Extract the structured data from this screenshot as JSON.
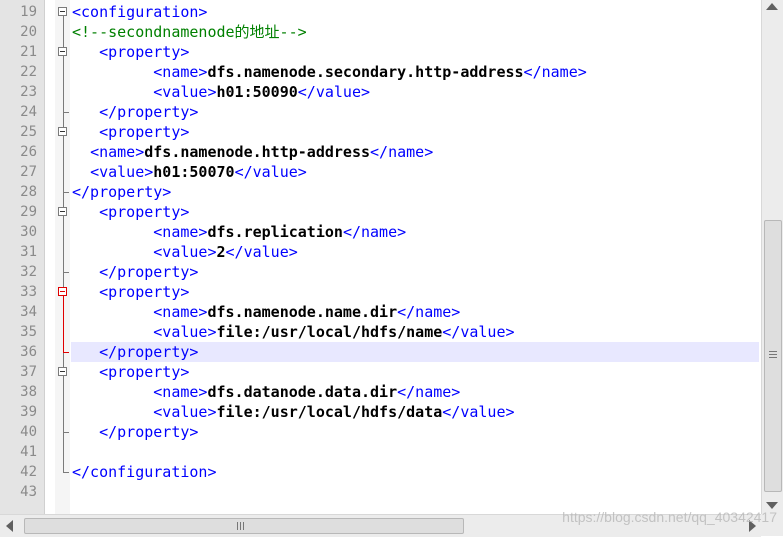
{
  "editor": {
    "lines": [
      {
        "num": "19",
        "indent": "",
        "parts": [
          {
            "t": "tag",
            "v": "<configuration>"
          }
        ]
      },
      {
        "num": "20",
        "indent": "",
        "parts": [
          {
            "t": "cmt",
            "v": "<!--secondnamenode的地址-->"
          }
        ]
      },
      {
        "num": "21",
        "indent": "   ",
        "parts": [
          {
            "t": "tag",
            "v": "<property>"
          }
        ]
      },
      {
        "num": "22",
        "indent": "         ",
        "parts": [
          {
            "t": "tag",
            "v": "<name>"
          },
          {
            "t": "val",
            "v": "dfs.namenode.secondary.http-address"
          },
          {
            "t": "tag",
            "v": "</name>"
          }
        ]
      },
      {
        "num": "23",
        "indent": "         ",
        "parts": [
          {
            "t": "tag",
            "v": "<value>"
          },
          {
            "t": "val",
            "v": "h01:50090"
          },
          {
            "t": "tag",
            "v": "</value>"
          }
        ]
      },
      {
        "num": "24",
        "indent": "   ",
        "parts": [
          {
            "t": "tag",
            "v": "</property>"
          }
        ]
      },
      {
        "num": "25",
        "indent": "   ",
        "parts": [
          {
            "t": "tag",
            "v": "<property>"
          }
        ]
      },
      {
        "num": "26",
        "indent": "  ",
        "parts": [
          {
            "t": "tag",
            "v": "<name>"
          },
          {
            "t": "val",
            "v": "dfs.namenode.http-address"
          },
          {
            "t": "tag",
            "v": "</name>"
          }
        ]
      },
      {
        "num": "27",
        "indent": "  ",
        "parts": [
          {
            "t": "tag",
            "v": "<value>"
          },
          {
            "t": "val",
            "v": "h01:50070"
          },
          {
            "t": "tag",
            "v": "</value>"
          }
        ]
      },
      {
        "num": "28",
        "indent": "",
        "parts": [
          {
            "t": "tag",
            "v": "</property>"
          }
        ]
      },
      {
        "num": "29",
        "indent": "   ",
        "parts": [
          {
            "t": "tag",
            "v": "<property>"
          }
        ]
      },
      {
        "num": "30",
        "indent": "         ",
        "parts": [
          {
            "t": "tag",
            "v": "<name>"
          },
          {
            "t": "val",
            "v": "dfs.replication"
          },
          {
            "t": "tag",
            "v": "</name>"
          }
        ]
      },
      {
        "num": "31",
        "indent": "         ",
        "parts": [
          {
            "t": "tag",
            "v": "<value>"
          },
          {
            "t": "val",
            "v": "2"
          },
          {
            "t": "tag",
            "v": "</value>"
          }
        ]
      },
      {
        "num": "32",
        "indent": "   ",
        "parts": [
          {
            "t": "tag",
            "v": "</property>"
          }
        ]
      },
      {
        "num": "33",
        "indent": "   ",
        "parts": [
          {
            "t": "tag",
            "v": "<property>"
          }
        ]
      },
      {
        "num": "34",
        "indent": "         ",
        "parts": [
          {
            "t": "tag",
            "v": "<name>"
          },
          {
            "t": "val",
            "v": "dfs.namenode.name.dir"
          },
          {
            "t": "tag",
            "v": "</name>"
          }
        ]
      },
      {
        "num": "35",
        "indent": "         ",
        "parts": [
          {
            "t": "tag",
            "v": "<value>"
          },
          {
            "t": "val",
            "v": "file:/usr/local/hdfs/name"
          },
          {
            "t": "tag",
            "v": "</value>"
          }
        ]
      },
      {
        "num": "36",
        "indent": "   ",
        "parts": [
          {
            "t": "tag",
            "v": "</property>"
          }
        ]
      },
      {
        "num": "37",
        "indent": "   ",
        "parts": [
          {
            "t": "tag",
            "v": "<property>"
          }
        ]
      },
      {
        "num": "38",
        "indent": "         ",
        "parts": [
          {
            "t": "tag",
            "v": "<name>"
          },
          {
            "t": "val",
            "v": "dfs.datanode.data.dir"
          },
          {
            "t": "tag",
            "v": "</name>"
          }
        ]
      },
      {
        "num": "39",
        "indent": "         ",
        "parts": [
          {
            "t": "tag",
            "v": "<value>"
          },
          {
            "t": "val",
            "v": "file:/usr/local/hdfs/data"
          },
          {
            "t": "tag",
            "v": "</value>"
          }
        ]
      },
      {
        "num": "40",
        "indent": "   ",
        "parts": [
          {
            "t": "tag",
            "v": "</property>"
          }
        ]
      },
      {
        "num": "41",
        "indent": "",
        "parts": []
      },
      {
        "num": "42",
        "indent": "",
        "parts": [
          {
            "t": "tag",
            "v": "</configuration>"
          }
        ]
      },
      {
        "num": "43",
        "indent": "",
        "parts": []
      }
    ],
    "current_line": "36",
    "colors": {
      "tag": "#0000ff",
      "comment": "#008000",
      "value": "#000000",
      "current_line_bg": "#e8e8ff",
      "fold_active": "#e00000"
    }
  },
  "watermark": "https://blog.csdn.net/qq_40342417"
}
